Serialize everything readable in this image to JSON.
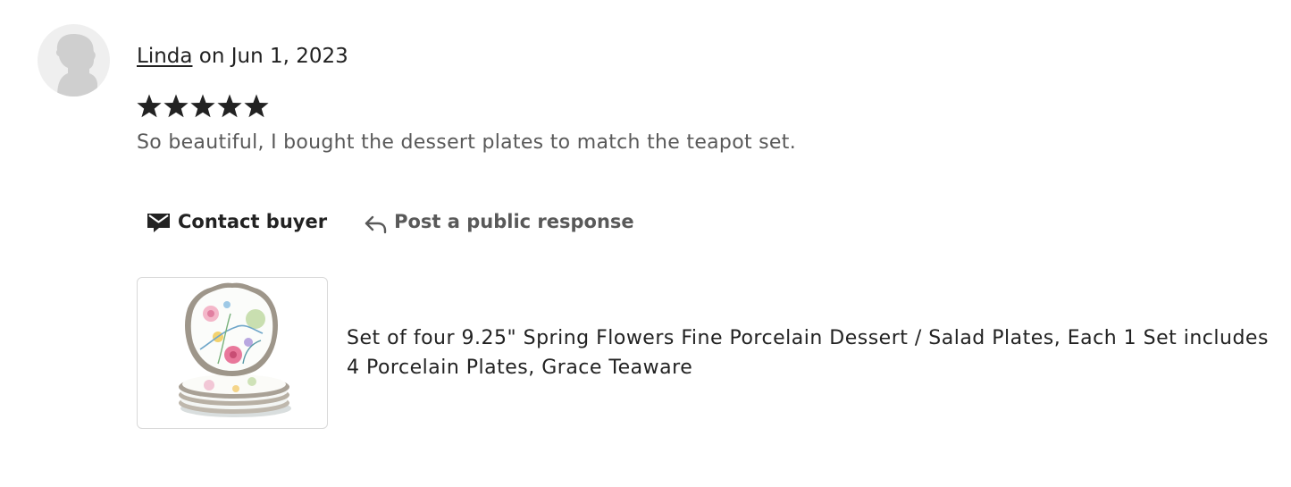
{
  "review": {
    "reviewer_name": "Linda",
    "date_text": "on Jun 1, 2023",
    "rating": 5,
    "rating_max": 5,
    "text": "So beautiful, I bought the dessert plates to match the teapot set.",
    "avatar_icon": "default-avatar-silhouette"
  },
  "actions": {
    "contact_label": "Contact buyer",
    "contact_icon": "envelope-icon",
    "respond_label": "Post a public response",
    "respond_icon": "reply-arrow-icon"
  },
  "product": {
    "title": "Set of four 9.25\" Spring Flowers Fine Porcelain Dessert / Salad Plates, Each 1 Set includes 4 Porcelain Plates, Grace Teaware",
    "image_description_icon": "floral-plates-thumbnail"
  },
  "colors": {
    "text_primary": "#222222",
    "text_secondary": "#595959",
    "star": "#222222",
    "avatar_bg": "#efefef",
    "avatar_figure": "#cfcfcf"
  }
}
